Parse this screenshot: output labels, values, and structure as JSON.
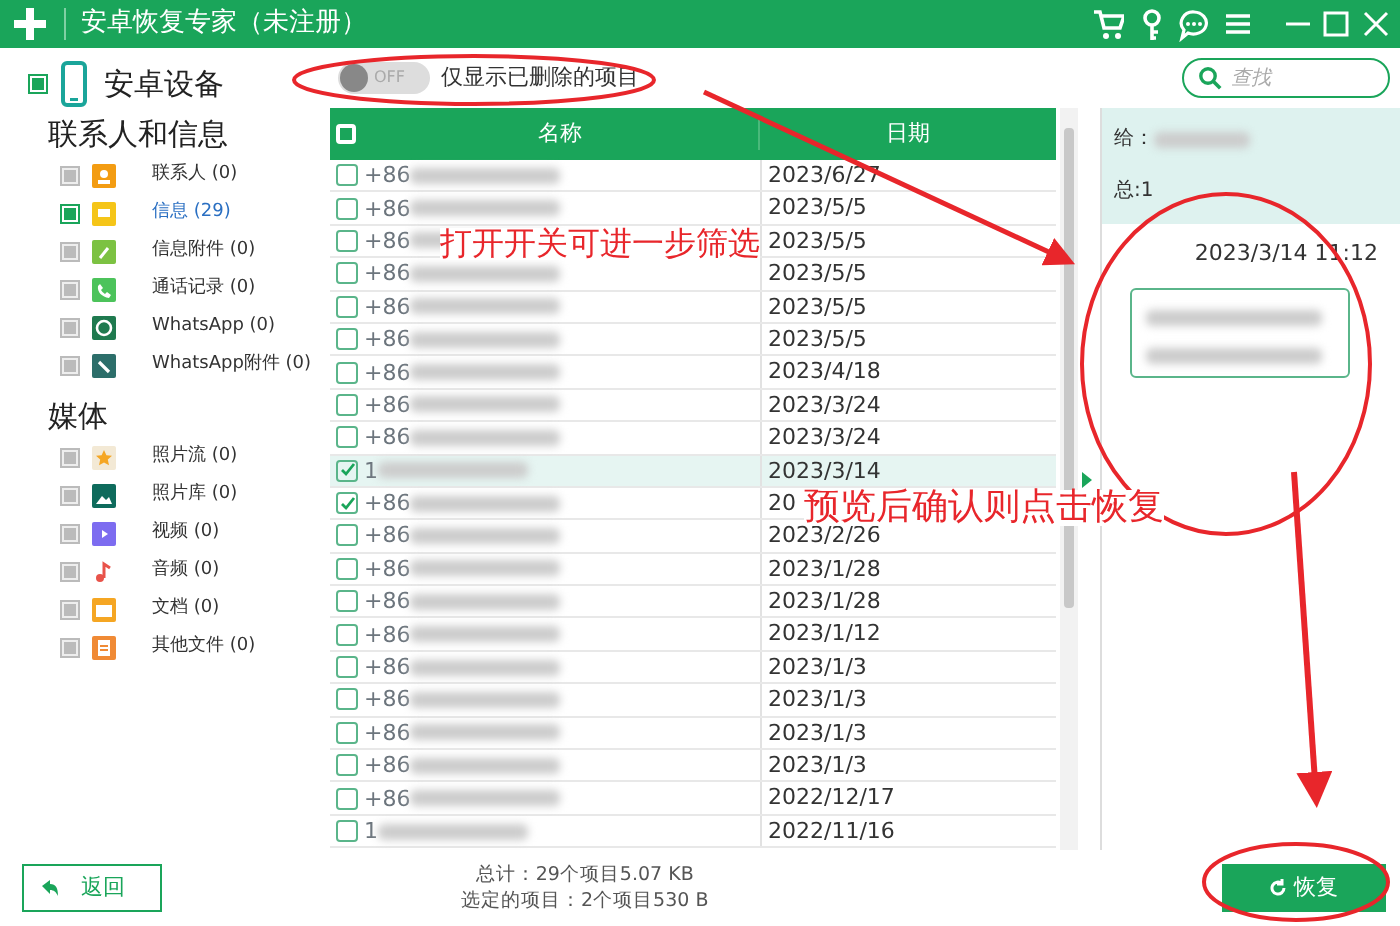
{
  "window": {
    "title": "安卓恢复专家（未注册）"
  },
  "device": {
    "label": "安卓设备",
    "checked": true
  },
  "sidebar": [
    {
      "heading": "联系人和信息",
      "items": [
        {
          "label": "联系人 (0)",
          "selected": false,
          "checked": false
        },
        {
          "label": "信息 (29)",
          "selected": true,
          "checked": true
        },
        {
          "label": "信息附件 (0)",
          "selected": false,
          "checked": false
        },
        {
          "label": "通话记录 (0)",
          "selected": false,
          "checked": false
        },
        {
          "label": "WhatsApp (0)",
          "selected": false,
          "checked": false
        },
        {
          "label": "WhatsApp附件 (0)",
          "selected": false,
          "checked": false
        }
      ]
    },
    {
      "heading": "媒体",
      "items": [
        {
          "label": "照片流 (0)",
          "selected": false,
          "checked": false
        },
        {
          "label": "照片库 (0)",
          "selected": false,
          "checked": false
        },
        {
          "label": "视频 (0)",
          "selected": false,
          "checked": false
        },
        {
          "label": "音频 (0)",
          "selected": false,
          "checked": false
        },
        {
          "label": "文档 (0)",
          "selected": false,
          "checked": false
        },
        {
          "label": "其他文件 (0)",
          "selected": false,
          "checked": false
        }
      ]
    }
  ],
  "toggle": {
    "state": "OFF",
    "on": false,
    "label": "仅显示已删除的项目"
  },
  "search": {
    "placeholder": "查找"
  },
  "table": {
    "columns": [
      "名称",
      "日期"
    ],
    "all_checked": false,
    "rows": [
      {
        "name": "+86",
        "date": "2023/6/27",
        "checked": false,
        "selected": false
      },
      {
        "name": "+86",
        "date": "2023/5/5",
        "checked": false,
        "selected": false
      },
      {
        "name": "+86",
        "date": "2023/5/5",
        "checked": false,
        "selected": false
      },
      {
        "name": "+86",
        "date": "2023/5/5",
        "checked": false,
        "selected": false
      },
      {
        "name": "+86",
        "date": "2023/5/5",
        "checked": false,
        "selected": false
      },
      {
        "name": "+86",
        "date": "2023/5/5",
        "checked": false,
        "selected": false
      },
      {
        "name": "+86",
        "date": "2023/4/18",
        "checked": false,
        "selected": false
      },
      {
        "name": "+86",
        "date": "2023/3/24",
        "checked": false,
        "selected": false
      },
      {
        "name": "+86",
        "date": "2023/3/24",
        "checked": false,
        "selected": false
      },
      {
        "name": "1",
        "date": "2023/3/14",
        "checked": true,
        "selected": true
      },
      {
        "name": "+86",
        "date": "20",
        "checked": true,
        "selected": false
      },
      {
        "name": "+86",
        "date": "2023/2/26",
        "checked": false,
        "selected": false
      },
      {
        "name": "+86",
        "date": "2023/1/28",
        "checked": false,
        "selected": false
      },
      {
        "name": "+86",
        "date": "2023/1/28",
        "checked": false,
        "selected": false
      },
      {
        "name": "+86",
        "date": "2023/1/12",
        "checked": false,
        "selected": false
      },
      {
        "name": "+86",
        "date": "2023/1/3",
        "checked": false,
        "selected": false
      },
      {
        "name": "+86",
        "date": "2023/1/3",
        "checked": false,
        "selected": false
      },
      {
        "name": "+86",
        "date": "2023/1/3",
        "checked": false,
        "selected": false
      },
      {
        "name": "+86",
        "date": "2023/1/3",
        "checked": false,
        "selected": false
      },
      {
        "name": "+86",
        "date": "2022/12/17",
        "checked": false,
        "selected": false
      },
      {
        "name": "1",
        "date": "2022/11/16",
        "checked": false,
        "selected": false
      }
    ]
  },
  "preview": {
    "to": "给：",
    "total": "总:1",
    "time": "2023/3/14 11:12"
  },
  "footer": {
    "back": "返回",
    "total": "总计：29个项目5.07 KB",
    "selected": "选定的项目：2个项目530 B",
    "restore": "恢复"
  },
  "annotations": [
    {
      "kind": "label",
      "text": "打开开关可进一步筛选"
    },
    {
      "kind": "label",
      "text": "预览后确认则点击恢复"
    }
  ]
}
